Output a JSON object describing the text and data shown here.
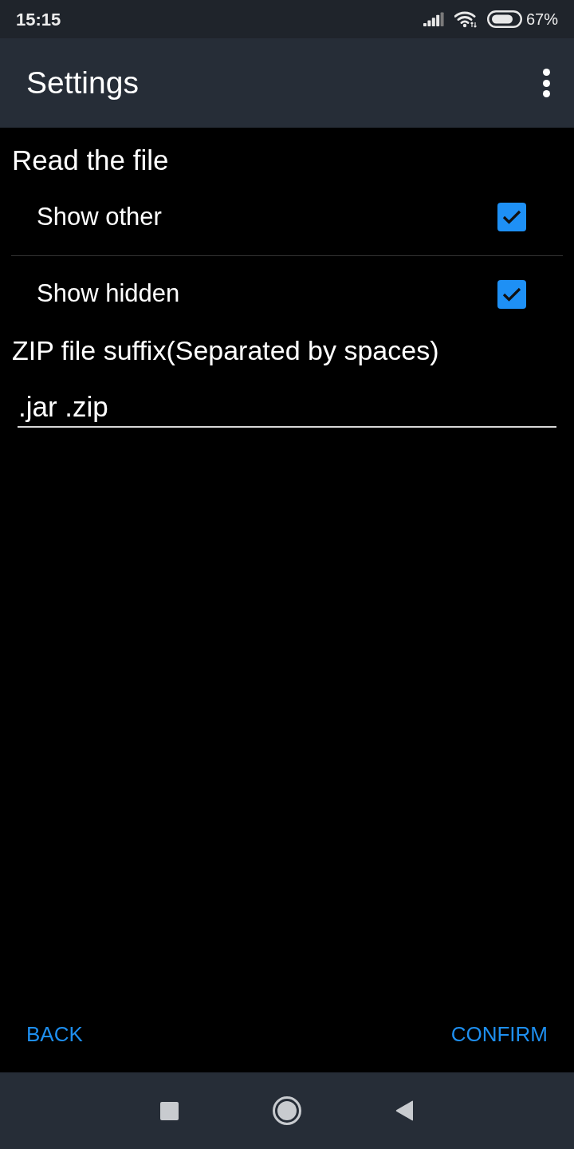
{
  "status_bar": {
    "time": "15:15",
    "battery": "67%"
  },
  "app_bar": {
    "title": "Settings"
  },
  "sections": [
    {
      "title": "Read the file",
      "items": [
        {
          "label": "Show other",
          "checked": true
        },
        {
          "label": "Show hidden",
          "checked": true
        }
      ]
    }
  ],
  "suffix_field": {
    "label": "ZIP file suffix(Separated by spaces)",
    "value": ".jar .zip"
  },
  "buttons": [
    {
      "label": "BACK"
    },
    {
      "label": "CONFIRM"
    }
  ]
}
